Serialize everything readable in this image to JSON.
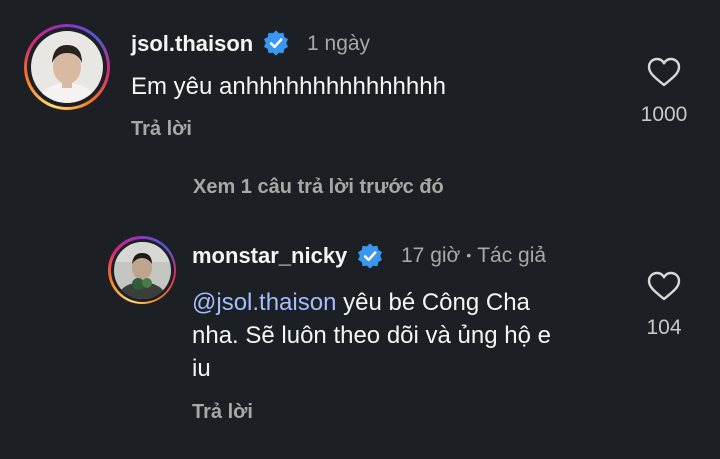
{
  "comment": {
    "username": "jsol.thaison",
    "time": "1 ngày",
    "text": "Em yêu anhhhhhhhhhhhhhhh",
    "reply_label": "Trả lời",
    "like_count": "1000"
  },
  "view_more": "Xem 1 câu trả lời trước đó",
  "reply": {
    "username": "monstar_nicky",
    "time": "17 giờ",
    "separator": "•",
    "author_badge": "Tác giả",
    "mention": "@jsol.thaison",
    "text_line1_rest": " yêu bé Công Cha",
    "text_line2": "nha. Sẽ luôn theo dõi và ủng hộ e",
    "text_line3": "iu",
    "reply_label": "Trả lời",
    "like_count": "104"
  },
  "colors": {
    "background": "#1c1f24",
    "verified": "#3897f0",
    "mention": "#a3bdfd",
    "secondary_text": "#a8a8a8"
  }
}
